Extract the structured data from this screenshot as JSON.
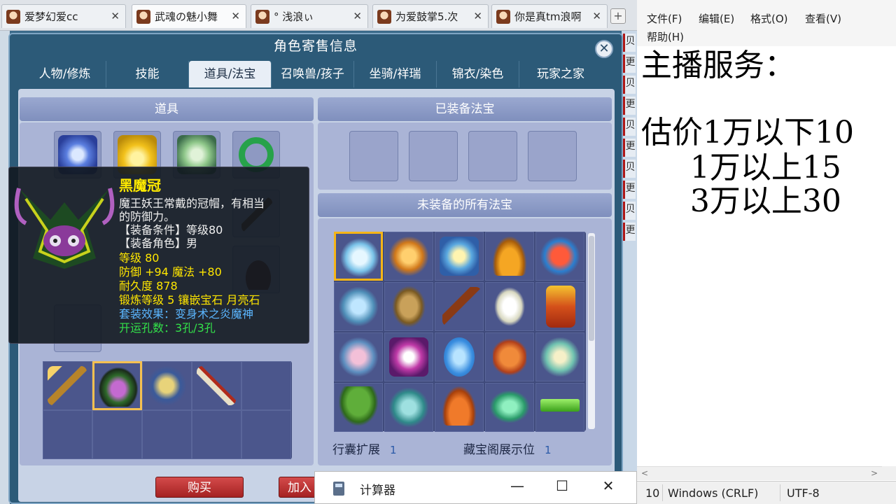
{
  "browser_tabs": [
    {
      "label": "爱梦幻爱cc",
      "active": false
    },
    {
      "label": "武魂の魅小舞",
      "active": true
    },
    {
      "label": "° 浅浪ぃ",
      "active": false
    },
    {
      "label": "为爱鼓掌5.次",
      "active": false
    },
    {
      "label": "你是真tm浪啊",
      "active": false
    }
  ],
  "side_strip": [
    "贝",
    "更",
    "贝",
    "更",
    "贝",
    "更",
    "贝",
    "更",
    "贝",
    "更"
  ],
  "window": {
    "title": "角色寄售信息",
    "tabs": [
      "人物/修炼",
      "技能",
      "道具/法宝",
      "召唤兽/孩子",
      "坐骑/祥瑞",
      "锦衣/染色",
      "玩家之家"
    ],
    "active_tab": 2
  },
  "panels": {
    "items_head": "道具",
    "equipped_head": "已装备法宝",
    "all_fabao_head": "未装备的所有法宝",
    "bag_expand_label": "行囊扩展",
    "bag_expand_value": "1",
    "cangbao_label": "藏宝阁展示位",
    "cangbao_value": "1"
  },
  "buttons": {
    "buy": "购买",
    "add": "加入"
  },
  "tooltip": {
    "name": "黑魔冠",
    "desc1": "魔王妖王常戴的冠帽，有相当",
    "desc2": "的防御力。",
    "req_level": "【装备条件】等级80",
    "req_role": "【装备角色】男",
    "level": "等级 80",
    "defense": "防御 +94  魔法 +80",
    "durability": "耐久度 878",
    "refine": "锻炼等级 5   镶嵌宝石  月亮石",
    "set_effect": "套装效果：变身术之炎魔神",
    "holes": "开运孔数：3孔/3孔"
  },
  "calculator": {
    "title": "计算器"
  },
  "notepad": {
    "menu": [
      "文件(F)",
      "编辑(E)",
      "格式(O)",
      "查看(V)",
      "帮助(H)"
    ],
    "lines": [
      "主播服务：",
      "",
      "估价1万以下10",
      "     1万以上15",
      "     3万以上30"
    ],
    "status_pos": "10",
    "status_eol": "Windows (CRLF)",
    "status_enc": "UTF-8"
  },
  "colors": {
    "accent_red": "#b01818",
    "gold_border": "#f5b517",
    "tooltip_name": "#ffea00"
  }
}
